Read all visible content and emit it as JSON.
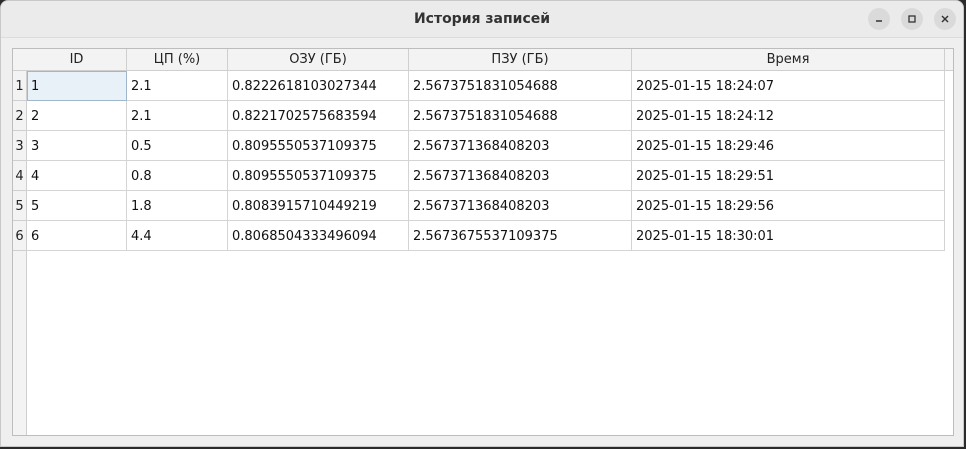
{
  "window": {
    "title": "История записей"
  },
  "table": {
    "headers": [
      "ID",
      "ЦП (%)",
      "ОЗУ (ГБ)",
      "ПЗУ (ГБ)",
      "Время"
    ],
    "row_numbers": [
      "1",
      "2",
      "3",
      "4",
      "5",
      "6"
    ],
    "rows": [
      [
        "1",
        "2.1",
        "0.8222618103027344",
        "2.5673751831054688",
        "2025-01-15 18:24:07"
      ],
      [
        "2",
        "2.1",
        "0.8221702575683594",
        "2.5673751831054688",
        "2025-01-15 18:24:12"
      ],
      [
        "3",
        "0.5",
        "0.8095550537109375",
        "2.567371368408203",
        "2025-01-15 18:29:46"
      ],
      [
        "4",
        "0.8",
        "0.8095550537109375",
        "2.567371368408203",
        "2025-01-15 18:29:51"
      ],
      [
        "5",
        "1.8",
        "0.8083915710449219",
        "2.567371368408203",
        "2025-01-15 18:29:56"
      ],
      [
        "6",
        "4.4",
        "0.8068504333496094",
        "2.5673675537109375",
        "2025-01-15 18:30:01"
      ]
    ]
  },
  "icons": {
    "minimize": "minimize-icon",
    "maximize": "maximize-icon",
    "close": "close-icon"
  },
  "colors": {
    "selection": "#e8f0f8",
    "titlebar": "#ebebeb"
  }
}
